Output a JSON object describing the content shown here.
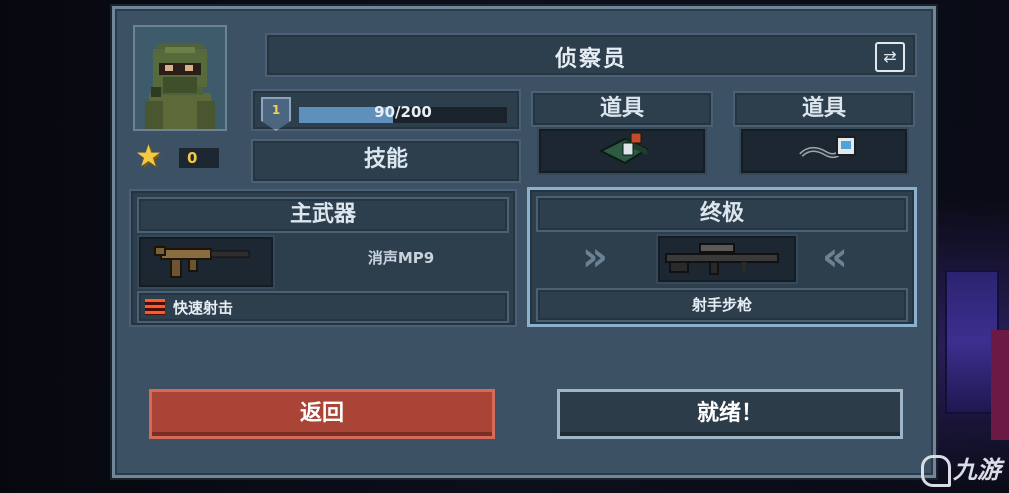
{
  "character": {
    "name": "侦察员",
    "stars": "0",
    "level": "1",
    "xp_current": 90,
    "xp_max": 200,
    "xp_text": "90/200",
    "xp_fraction": 0.45,
    "skill_label": "技能"
  },
  "items": [
    {
      "label": "道具",
      "icon": "landmine-icon"
    },
    {
      "label": "道具",
      "icon": "grappling-hook-icon"
    }
  ],
  "primary_weapon": {
    "header": "主武器",
    "name": "消声MP9",
    "perk": "快速射击",
    "icon": "smg-icon"
  },
  "ultimate": {
    "header": "终极",
    "name": "射手步枪",
    "icon": "sniper-rifle-icon"
  },
  "buttons": {
    "back": "返回",
    "ready": "就绪！"
  },
  "watermark": "九游",
  "colors": {
    "panel": "#3c5163",
    "back_button": "#a94437",
    "star": "#f5c842",
    "xp_fill": "#5f90bb"
  }
}
